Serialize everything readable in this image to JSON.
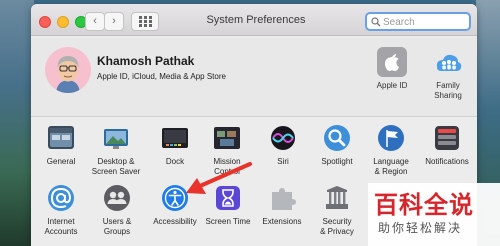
{
  "window": {
    "title": "System Preferences",
    "search_placeholder": "Search",
    "nav_back": "‹",
    "nav_forward": "›"
  },
  "user": {
    "name": "Khamosh Pathak",
    "subtitle": "Apple ID, iCloud, Media & App Store"
  },
  "utilities": [
    {
      "label": "Apple ID",
      "icon": "apple-logo-icon"
    },
    {
      "label": "Family\nSharing",
      "icon": "family-sharing-icon"
    }
  ],
  "row1": [
    {
      "label": "General",
      "icon": "general-icon"
    },
    {
      "label": "Desktop &\nScreen Saver",
      "icon": "desktop-screensaver-icon"
    },
    {
      "label": "Dock",
      "icon": "dock-icon"
    },
    {
      "label": "Mission\nControl",
      "icon": "mission-control-icon"
    },
    {
      "label": "Siri",
      "icon": "siri-icon"
    },
    {
      "label": "Spotlight",
      "icon": "spotlight-icon"
    },
    {
      "label": "Language\n& Region",
      "icon": "language-region-icon"
    },
    {
      "label": "Notifications",
      "icon": "notifications-icon"
    }
  ],
  "row2": [
    {
      "label": "Internet\nAccounts",
      "icon": "internet-accounts-icon"
    },
    {
      "label": "Users &\nGroups",
      "icon": "users-groups-icon"
    },
    {
      "label": "Accessibility",
      "icon": "accessibility-icon"
    },
    {
      "label": "Screen Time",
      "icon": "screen-time-icon"
    },
    {
      "label": "Extensions",
      "icon": "extensions-icon"
    },
    {
      "label": "Security\n& Privacy",
      "icon": "security-privacy-icon"
    }
  ],
  "watermark": {
    "big": "百科全说",
    "small": "助你轻松解决"
  },
  "colors": {
    "annotation_arrow": "#e8322a",
    "search_focus": "#6aa0e2"
  }
}
